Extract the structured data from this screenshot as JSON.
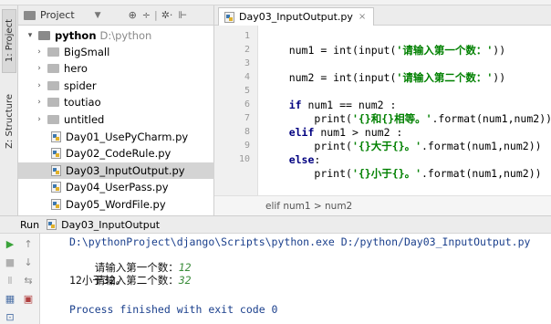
{
  "tool_strip": {
    "project_tab": "1: Project",
    "structure_tab": "Z: Structure"
  },
  "project_panel": {
    "title": "Project",
    "tree": [
      {
        "label": "python",
        "path": "D:\\python",
        "kind": "root-folder",
        "expanded": true
      },
      {
        "label": "BigSmall",
        "kind": "folder"
      },
      {
        "label": "hero",
        "kind": "folder"
      },
      {
        "label": "spider",
        "kind": "folder"
      },
      {
        "label": "toutiao",
        "kind": "folder"
      },
      {
        "label": "untitled",
        "kind": "folder"
      },
      {
        "label": "Day01_UsePyCharm.py",
        "kind": "py"
      },
      {
        "label": "Day02_CodeRule.py",
        "kind": "py"
      },
      {
        "label": "Day03_InputOutput.py",
        "kind": "py",
        "selected": true
      },
      {
        "label": "Day04_UserPass.py",
        "kind": "py"
      },
      {
        "label": "Day05_WordFile.py",
        "kind": "py"
      }
    ]
  },
  "editor": {
    "tab_label": "Day03_InputOutput.py",
    "line_numbers": [
      "1",
      "2",
      "3",
      "4",
      "5",
      "6",
      "7",
      "8",
      "9",
      "10"
    ],
    "lines": [
      {
        "p1": "num1 = int(input(",
        "s1": "'请输入第一个数：'",
        "p2": "))"
      },
      {},
      {
        "p1": "num2 = int(input(",
        "s1": "'请输入第二个数：'",
        "p2": "))"
      },
      {},
      {
        "k1": "if",
        "p1": " num1 == num2 :"
      },
      {
        "p1": "    print(",
        "s1": "'{}和{}相等。'",
        "p2": ".format(num1,num2))"
      },
      {
        "k1": "elif",
        "p1": " num1 > num2 :"
      },
      {
        "p1": "    print(",
        "s1": "'{}大于{}。'",
        "p2": ".format(num1,num2))"
      },
      {
        "k1": "else",
        "p1": ":"
      },
      {
        "p1": "    print(",
        "s1": "'{}小于{}。'",
        "p2": ".format(num1,num2))"
      }
    ],
    "breadcrumb": "elif num1 > num2"
  },
  "run_panel": {
    "label": "Run",
    "config_name": "Day03_InputOutput",
    "console": {
      "command": "D:\\pythonProject\\django\\Scripts\\python.exe D:/python/Day03_InputOutput.py",
      "prompt1": "请输入第一个数：",
      "input1": "12",
      "prompt2": "请输入第二个数：",
      "input2": "32",
      "result": "12小于32。",
      "finished": "Process finished with exit code 0"
    }
  },
  "colors": {
    "keyword": "#000080",
    "string": "#008000",
    "console_path": "#1a3f8c",
    "user_input": "#3a8c3a",
    "run_green": "#3aa33a"
  }
}
